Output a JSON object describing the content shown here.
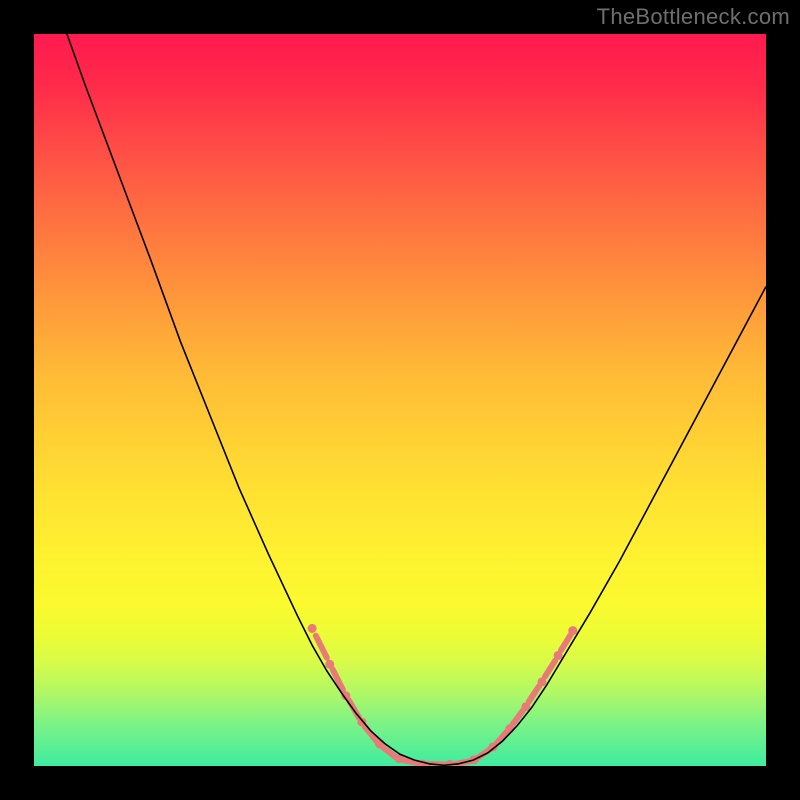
{
  "watermark": "TheBottleneck.com",
  "chart_data": {
    "type": "line",
    "title": "",
    "xlabel": "",
    "ylabel": "",
    "xlim": [
      0,
      100
    ],
    "ylim": [
      0,
      100
    ],
    "background_gradient_stops": [
      {
        "pos": 0,
        "color": "#ff1a4f"
      },
      {
        "pos": 100,
        "color": "#3fec9f"
      }
    ],
    "series": [
      {
        "name": "curve",
        "stroke": "#000000",
        "stroke_width": 1.6,
        "points": [
          {
            "x": 4.5,
            "y": 100
          },
          {
            "x": 7,
            "y": 93
          },
          {
            "x": 10,
            "y": 85
          },
          {
            "x": 13,
            "y": 77
          },
          {
            "x": 16,
            "y": 69
          },
          {
            "x": 20,
            "y": 58
          },
          {
            "x": 24,
            "y": 48
          },
          {
            "x": 28,
            "y": 38
          },
          {
            "x": 32,
            "y": 29
          },
          {
            "x": 36,
            "y": 20.5
          },
          {
            "x": 38,
            "y": 16.5
          },
          {
            "x": 40,
            "y": 13
          },
          {
            "x": 42,
            "y": 10
          },
          {
            "x": 44,
            "y": 7.2
          },
          {
            "x": 46,
            "y": 4.8
          },
          {
            "x": 48,
            "y": 3
          },
          {
            "x": 50,
            "y": 1.6
          },
          {
            "x": 52,
            "y": 0.8
          },
          {
            "x": 54,
            "y": 0.3
          },
          {
            "x": 56,
            "y": 0.1
          },
          {
            "x": 58,
            "y": 0.3
          },
          {
            "x": 60,
            "y": 0.8
          },
          {
            "x": 62,
            "y": 1.8
          },
          {
            "x": 64,
            "y": 3.4
          },
          {
            "x": 66,
            "y": 5.5
          },
          {
            "x": 68,
            "y": 8
          },
          {
            "x": 70,
            "y": 11
          },
          {
            "x": 73,
            "y": 16
          },
          {
            "x": 76,
            "y": 21
          },
          {
            "x": 80,
            "y": 28
          },
          {
            "x": 84,
            "y": 35.5
          },
          {
            "x": 88,
            "y": 43
          },
          {
            "x": 92,
            "y": 50.5
          },
          {
            "x": 96,
            "y": 58
          },
          {
            "x": 100,
            "y": 65.5
          }
        ]
      }
    ],
    "annotations": {
      "salmon_dashes": [
        {
          "x1": 38.5,
          "y1": 17.8,
          "x2": 40.0,
          "y2": 14.8
        },
        {
          "x1": 40.8,
          "y1": 13.2,
          "x2": 42.2,
          "y2": 10.4
        },
        {
          "x1": 43.0,
          "y1": 9.0,
          "x2": 44.4,
          "y2": 6.6
        },
        {
          "x1": 45.2,
          "y1": 5.4,
          "x2": 46.8,
          "y2": 3.4
        },
        {
          "x1": 47.6,
          "y1": 2.6,
          "x2": 49.4,
          "y2": 1.2
        },
        {
          "x1": 50.4,
          "y1": 0.8,
          "x2": 52.6,
          "y2": 0.35
        },
        {
          "x1": 53.8,
          "y1": 0.25,
          "x2": 56.2,
          "y2": 0.2
        },
        {
          "x1": 57.4,
          "y1": 0.25,
          "x2": 59.6,
          "y2": 0.65
        },
        {
          "x1": 60.6,
          "y1": 1.1,
          "x2": 62.2,
          "y2": 2.2
        },
        {
          "x1": 63.2,
          "y1": 3.1,
          "x2": 64.6,
          "y2": 4.7
        },
        {
          "x1": 65.4,
          "y1": 5.7,
          "x2": 66.8,
          "y2": 7.6
        },
        {
          "x1": 67.6,
          "y1": 8.8,
          "x2": 69.0,
          "y2": 10.9
        },
        {
          "x1": 69.8,
          "y1": 12.2,
          "x2": 71.2,
          "y2": 14.4
        },
        {
          "x1": 72.0,
          "y1": 15.8,
          "x2": 73.3,
          "y2": 17.9
        }
      ],
      "salmon_dots": [
        {
          "x": 38.0,
          "y": 18.8
        },
        {
          "x": 40.4,
          "y": 13.9
        },
        {
          "x": 42.6,
          "y": 9.6
        },
        {
          "x": 44.8,
          "y": 6.0
        },
        {
          "x": 47.2,
          "y": 3.0
        },
        {
          "x": 49.9,
          "y": 1.0
        },
        {
          "x": 53.1,
          "y": 0.25
        },
        {
          "x": 56.8,
          "y": 0.2
        },
        {
          "x": 60.1,
          "y": 0.85
        },
        {
          "x": 62.7,
          "y": 2.6
        },
        {
          "x": 65.0,
          "y": 5.1
        },
        {
          "x": 67.2,
          "y": 8.1
        },
        {
          "x": 69.4,
          "y": 11.5
        },
        {
          "x": 71.6,
          "y": 15.1
        },
        {
          "x": 73.6,
          "y": 18.5
        }
      ],
      "dash_stroke": "#e87a78",
      "dash_width": 6,
      "dot_fill": "#e87a78",
      "dot_radius": 4.5
    }
  }
}
